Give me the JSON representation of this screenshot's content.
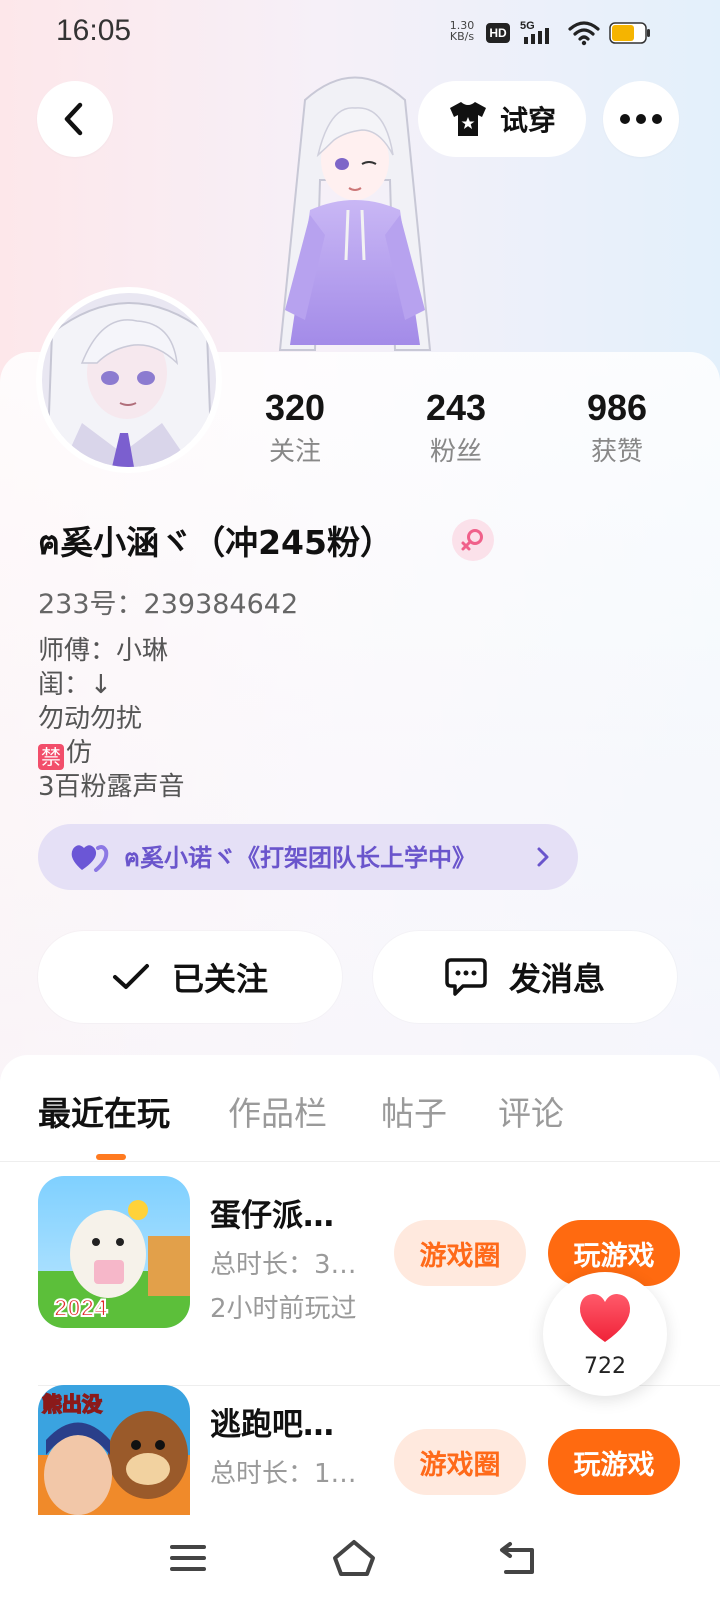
{
  "status_bar": {
    "time": "16:05",
    "net_speed_value": "1.30",
    "net_speed_unit": "KB/s",
    "hd": "HD",
    "network": "5G",
    "battery_color": "#f5b400"
  },
  "header": {
    "tryon_label": "试穿",
    "icons": [
      "back-icon",
      "tshirt-icon",
      "more-icon"
    ]
  },
  "stats": [
    {
      "value": "320",
      "label": "关注"
    },
    {
      "value": "243",
      "label": "粉丝"
    },
    {
      "value": "986",
      "label": "获赞"
    }
  ],
  "profile": {
    "username": "ฅ奚小涵ヾ（冲245粉）",
    "gender_icon": "female-icon",
    "uid": "233号：239384642",
    "bio": {
      "line1": "师傅：小琳",
      "line2": "闺：↓",
      "line3": "勿动勿扰",
      "ban_mark": "禁",
      "line4_text": "仿",
      "line5": "3百粉露声音"
    },
    "partner": "ฅ奚小诺ヾ《打架团队长上学中》"
  },
  "actions": {
    "follow_label": "已关注",
    "message_label": "发消息"
  },
  "tabs": [
    {
      "label": "最近在玩",
      "active": true
    },
    {
      "label": "作品栏",
      "active": false
    },
    {
      "label": "帖子",
      "active": false
    },
    {
      "label": "评论",
      "active": false
    }
  ],
  "games": [
    {
      "name": "蛋仔派…",
      "duration": "总时长：3…",
      "last_played": "2小时前玩过",
      "icon_badge": "2024",
      "circle_label": "游戏圈",
      "play_label": "玩游戏"
    },
    {
      "name": "逃跑吧…",
      "duration": "总时长：1…",
      "last_played": "",
      "icon_badge": "熊出没",
      "circle_label": "游戏圈",
      "play_label": "玩游戏"
    }
  ],
  "like_float": {
    "count": "722"
  },
  "colors": {
    "accent": "#ff6a10",
    "accent_light": "#ffe9de",
    "partner_bg": "#e5e0f6",
    "partner_text": "#6a55cc"
  }
}
